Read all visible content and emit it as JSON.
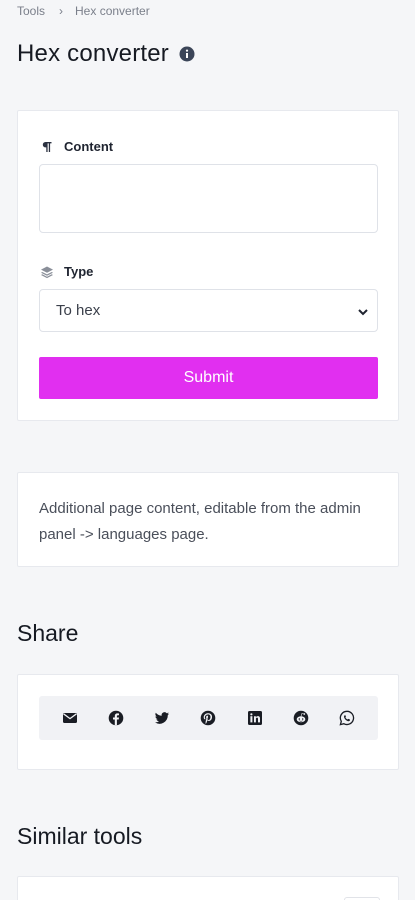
{
  "breadcrumb": {
    "root": "Tools",
    "separator": "›",
    "current": "Hex converter"
  },
  "page_title": "Hex converter",
  "form": {
    "content_label": "Content",
    "content_value": "",
    "type_label": "Type",
    "type_selected": "To hex",
    "submit_label": "Submit"
  },
  "extra": {
    "text": "Additional page content, editable from the admin panel -> languages page."
  },
  "share": {
    "title": "Share",
    "buttons": [
      "email-icon",
      "facebook-icon",
      "twitter-icon",
      "pinterest-icon",
      "linkedin-icon",
      "reddit-icon",
      "whatsapp-icon"
    ]
  },
  "similar": {
    "title": "Similar tools"
  },
  "colors": {
    "accent": "#e12ff0",
    "background": "#f5f6f8",
    "card": "#ffffff"
  }
}
